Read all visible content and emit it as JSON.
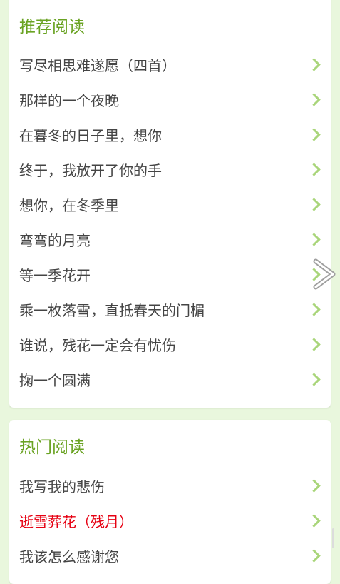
{
  "recommend": {
    "title": "推荐阅读",
    "items": [
      {
        "label": "写尽相思难遂愿（四首）"
      },
      {
        "label": "那样的一个夜晚"
      },
      {
        "label": "在暮冬的日子里，想你"
      },
      {
        "label": "终于，我放开了你的手"
      },
      {
        "label": "想你，在冬季里"
      },
      {
        "label": "弯弯的月亮"
      },
      {
        "label": "等一季花开"
      },
      {
        "label": "乘一枚落雪，直抵春天的门楣"
      },
      {
        "label": "谁说，残花一定会有忧伤"
      },
      {
        "label": "掬一个圆满"
      }
    ]
  },
  "hot": {
    "title": "热门阅读",
    "items": [
      {
        "label": "我写我的悲伤"
      },
      {
        "label": "逝雪葬花（残月）"
      },
      {
        "label": "我该怎么感谢您"
      }
    ]
  },
  "colors": {
    "title_green": "#6aa323",
    "chevron_green": "#a9d57a",
    "highlight_red": "#e60012",
    "background": "#e9f7dd"
  },
  "icons": {
    "row_chevron": "chevron-right-icon",
    "pager": "next-page-arrow-icon"
  }
}
